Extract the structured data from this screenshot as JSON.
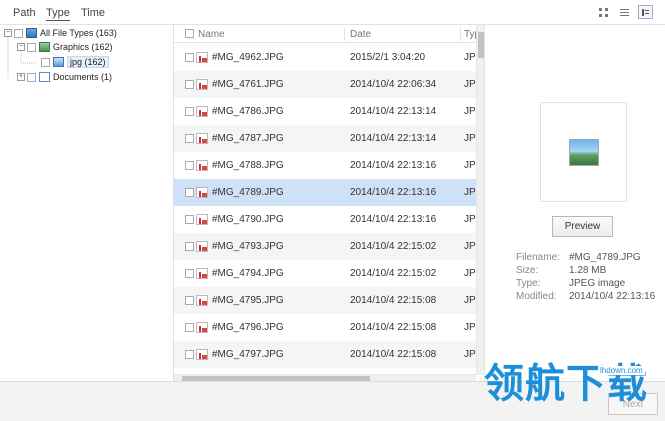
{
  "tabs": [
    "Path",
    "Type",
    "Time"
  ],
  "view_buttons": [
    "thumbnail-view-icon",
    "list-view-icon",
    "detail-view-icon"
  ],
  "tree": [
    {
      "label": "All File Types (163)",
      "icon": "folder-all-icon"
    },
    {
      "label": "Graphics (162)",
      "icon": "graphics-icon"
    },
    {
      "label": "jpg (162)",
      "icon": "jpg-icon"
    },
    {
      "label": "Documents (1)",
      "icon": "document-icon"
    }
  ],
  "columns": {
    "name": "Name",
    "date": "Date",
    "type": "Typ"
  },
  "files": [
    {
      "name": "#MG_4962.JPG",
      "date": "2015/2/1 3:04:20",
      "type": "JPI"
    },
    {
      "name": "#MG_4761.JPG",
      "date": "2014/10/4 22:06:34",
      "type": "JPI"
    },
    {
      "name": "#MG_4786.JPG",
      "date": "2014/10/4 22:13:14",
      "type": "JPI"
    },
    {
      "name": "#MG_4787.JPG",
      "date": "2014/10/4 22:13:14",
      "type": "JPI"
    },
    {
      "name": "#MG_4788.JPG",
      "date": "2014/10/4 22:13:16",
      "type": "JPI"
    },
    {
      "name": "#MG_4789.JPG",
      "date": "2014/10/4 22:13:16",
      "type": "JPI"
    },
    {
      "name": "#MG_4790.JPG",
      "date": "2014/10/4 22:13:16",
      "type": "JPI"
    },
    {
      "name": "#MG_4793.JPG",
      "date": "2014/10/4 22:15:02",
      "type": "JPI"
    },
    {
      "name": "#MG_4794.JPG",
      "date": "2014/10/4 22:15:02",
      "type": "JPI"
    },
    {
      "name": "#MG_4795.JPG",
      "date": "2014/10/4 22:15:08",
      "type": "JPI"
    },
    {
      "name": "#MG_4796.JPG",
      "date": "2014/10/4 22:15:08",
      "type": "JPI"
    },
    {
      "name": "#MG_4797.JPG",
      "date": "2014/10/4 22:15:08",
      "type": "JPI"
    }
  ],
  "preview": {
    "button_label": "Preview",
    "details": [
      {
        "key": "Filename:",
        "value": "#MG_4789.JPG"
      },
      {
        "key": "Size:",
        "value": "1.28 MB"
      },
      {
        "key": "Type:",
        "value": "JPEG image"
      },
      {
        "key": "Modified:",
        "value": "2014/10/4 22:13:16"
      }
    ]
  },
  "footer": {
    "next_label": "Next"
  },
  "watermark": {
    "text": "领航下载",
    "url": "lhdown.com"
  },
  "colors": {
    "selected_row": "#cfe1f7",
    "alt_row": "#f4f5f7",
    "watermark": "#1c8fd8"
  }
}
